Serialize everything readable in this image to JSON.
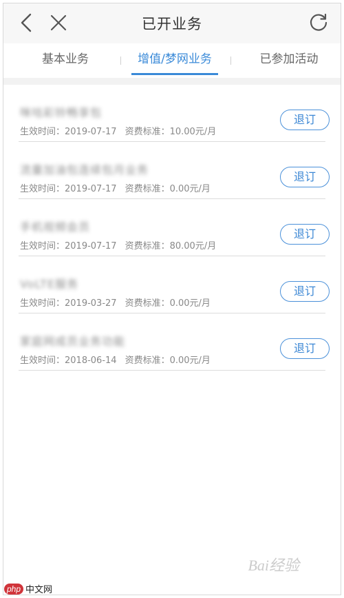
{
  "header": {
    "title": "已开业务",
    "back_icon": "chevron-left-icon",
    "close_icon": "close-icon",
    "refresh_icon": "refresh-icon"
  },
  "tabs": [
    {
      "label": "基本业务",
      "active": false
    },
    {
      "label": "增值/梦网业务",
      "active": true
    },
    {
      "label": "已参加活动",
      "active": false
    }
  ],
  "items": [
    {
      "name": "咪咕彩铃畅享包",
      "effective_label": "生效时间：",
      "effective_date": "2019-07-17",
      "fee_label": "资费标准：",
      "fee": "10.00元/月",
      "button": "退订"
    },
    {
      "name": "流量加油包连续包月业务",
      "effective_label": "生效时间：",
      "effective_date": "2019-07-17",
      "fee_label": "资费标准：",
      "fee": "0.00元/月",
      "button": "退订"
    },
    {
      "name": "手机视频会员",
      "effective_label": "生效时间：",
      "effective_date": "2019-07-17",
      "fee_label": "资费标准：",
      "fee": "80.00元/月",
      "button": "退订"
    },
    {
      "name": "VoLTE服务",
      "effective_label": "生效时间：",
      "effective_date": "2019-03-27",
      "fee_label": "资费标准：",
      "fee": "0.00元/月",
      "button": "退订"
    },
    {
      "name": "家庭网成员业务功能",
      "effective_label": "生效时间：",
      "effective_date": "2018-06-14",
      "fee_label": "资费标准：",
      "fee": "0.00元/月",
      "button": "退订"
    }
  ],
  "watermarks": {
    "baidu": "Bai经验",
    "php_badge": "php",
    "php_text": "中文网"
  },
  "colors": {
    "accent": "#3a8ad8",
    "header_bg": "#f7f7f7",
    "divider": "#dcdcdc"
  }
}
